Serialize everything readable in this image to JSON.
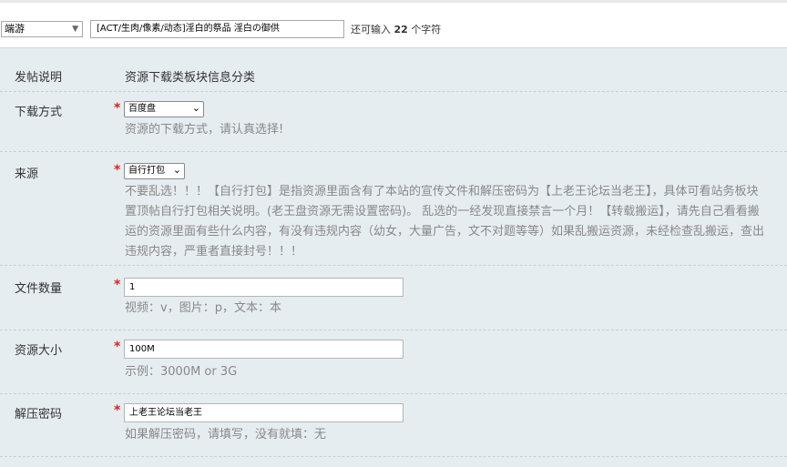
{
  "header": {
    "category_select": "端游",
    "title_value": "[ACT/生肉/像素/动态]淫白的祭品 淫白の御供",
    "remain_prefix": "还可输入",
    "remain_count": "22",
    "remain_suffix": "个字符"
  },
  "form": {
    "intro": {
      "label": "发帖说明",
      "value": "资源下载类板块信息分类"
    },
    "download_method": {
      "label": "下载方式",
      "required_mark": "*",
      "selected": "百度盘",
      "tip": "资源的下载方式，请认真选择!"
    },
    "source": {
      "label": "来源",
      "required_mark": "*",
      "selected": "自行打包",
      "tip_lines": [
        "不要乱选！！！【自行打包】是指资源里面含有了本站的宣传文件和解压密码为【上老王论坛当老王】，具体可看站务板块",
        "置顶帖自行打包相关说明。(老王盘资源无需设置密码)。 乱选的一经发现直接禁言一个月！【转载搬运】，请先自己看看搬",
        "运的资源里面有些什么内容，有没有违规内容（幼女，大量广告，文不对题等等）如果乱搬运资源，未经检查乱搬运，查出",
        "违规内容，严重者直接封号！！！"
      ]
    },
    "file_count": {
      "label": "文件数量",
      "required_mark": "*",
      "value": "1",
      "tip": "视频：v，图片：p，文本：本"
    },
    "size": {
      "label": "资源大小",
      "required_mark": "*",
      "value": "100M",
      "tip": "示例：3000M or 3G"
    },
    "password": {
      "label": "解压密码",
      "required_mark": "*",
      "value": "上老王论坛当老王",
      "tip": "如果解压密码，请填写，没有就填：无"
    }
  }
}
